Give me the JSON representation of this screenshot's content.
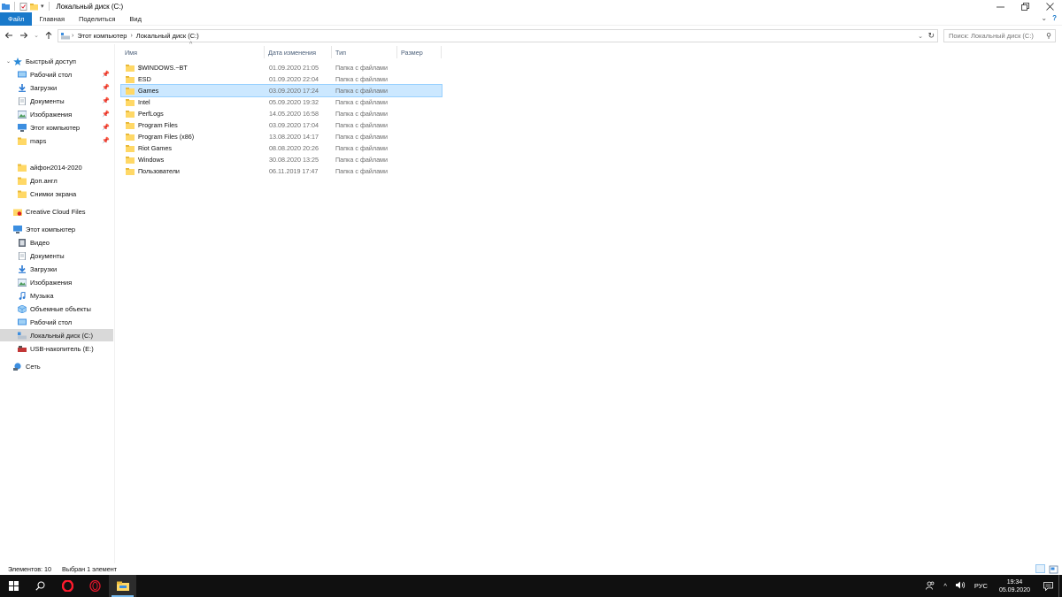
{
  "window": {
    "title": "Локальный диск (C:)"
  },
  "ribbon": {
    "tabs": [
      "Файл",
      "Главная",
      "Поделиться",
      "Вид"
    ]
  },
  "address": {
    "crumbs": [
      "Этот компьютер",
      "Локальный диск (C:)"
    ],
    "search_placeholder": "Поиск: Локальный диск (C:)"
  },
  "nav": {
    "quick_access": "Быстрый доступ",
    "quick_items": [
      {
        "label": "Рабочий стол",
        "icon": "desktop-icon",
        "pinned": true
      },
      {
        "label": "Загрузки",
        "icon": "downloads-icon",
        "pinned": true
      },
      {
        "label": "Документы",
        "icon": "documents-icon",
        "pinned": true
      },
      {
        "label": "Изображения",
        "icon": "pictures-icon",
        "pinned": true
      },
      {
        "label": "Этот компьютер",
        "icon": "computer-icon",
        "pinned": true
      },
      {
        "label": "maps",
        "icon": "folder-icon",
        "pinned": true
      }
    ],
    "recent_items": [
      {
        "label": "айфон2014-2020",
        "icon": "folder-icon"
      },
      {
        "label": "Доп.англ",
        "icon": "folder-icon"
      },
      {
        "label": "Снимки экрана",
        "icon": "folder-icon"
      }
    ],
    "creative_cloud": "Creative Cloud Files",
    "this_pc": "Этот компьютер",
    "pc_items": [
      {
        "label": "Видео",
        "icon": "video-icon"
      },
      {
        "label": "Документы",
        "icon": "documents-icon"
      },
      {
        "label": "Загрузки",
        "icon": "downloads-icon"
      },
      {
        "label": "Изображения",
        "icon": "pictures-icon"
      },
      {
        "label": "Музыка",
        "icon": "music-icon"
      },
      {
        "label": "Объемные объекты",
        "icon": "3d-objects-icon"
      },
      {
        "label": "Рабочий стол",
        "icon": "desktop-icon"
      },
      {
        "label": "Локальный диск (C:)",
        "icon": "drive-icon"
      },
      {
        "label": "USB-накопитель (E:)",
        "icon": "usb-drive-icon"
      }
    ],
    "network": "Сеть"
  },
  "columns": {
    "name": "Имя",
    "date": "Дата изменения",
    "type": "Тип",
    "size": "Размер"
  },
  "files": [
    {
      "name": "$WINDOWS.~BT",
      "date": "01.09.2020 21:05",
      "type": "Папка с файлами"
    },
    {
      "name": "ESD",
      "date": "01.09.2020 22:04",
      "type": "Папка с файлами"
    },
    {
      "name": "Games",
      "date": "03.09.2020 17:24",
      "type": "Папка с файлами"
    },
    {
      "name": "Intel",
      "date": "05.09.2020 19:32",
      "type": "Папка с файлами"
    },
    {
      "name": "PerfLogs",
      "date": "14.05.2020 16:58",
      "type": "Папка с файлами"
    },
    {
      "name": "Program Files",
      "date": "03.09.2020 17:04",
      "type": "Папка с файлами"
    },
    {
      "name": "Program Files (x86)",
      "date": "13.08.2020 14:17",
      "type": "Папка с файлами"
    },
    {
      "name": "Riot Games",
      "date": "08.08.2020 20:26",
      "type": "Папка с файлами"
    },
    {
      "name": "Windows",
      "date": "30.08.2020 13:25",
      "type": "Папка с файлами"
    },
    {
      "name": "Пользователи",
      "date": "06.11.2019 17:47",
      "type": "Папка с файлами"
    }
  ],
  "selected_file": "Games",
  "status": {
    "count": "Элементов: 10",
    "selection": "Выбран 1 элемент"
  },
  "taskbar": {
    "lang": "РУС",
    "time": "19:34",
    "date": "05.09.2020"
  },
  "colors": {
    "accent": "#1979ca",
    "selection": "#cce8ff",
    "folder": "#ffd866",
    "taskbar": "#101010"
  }
}
